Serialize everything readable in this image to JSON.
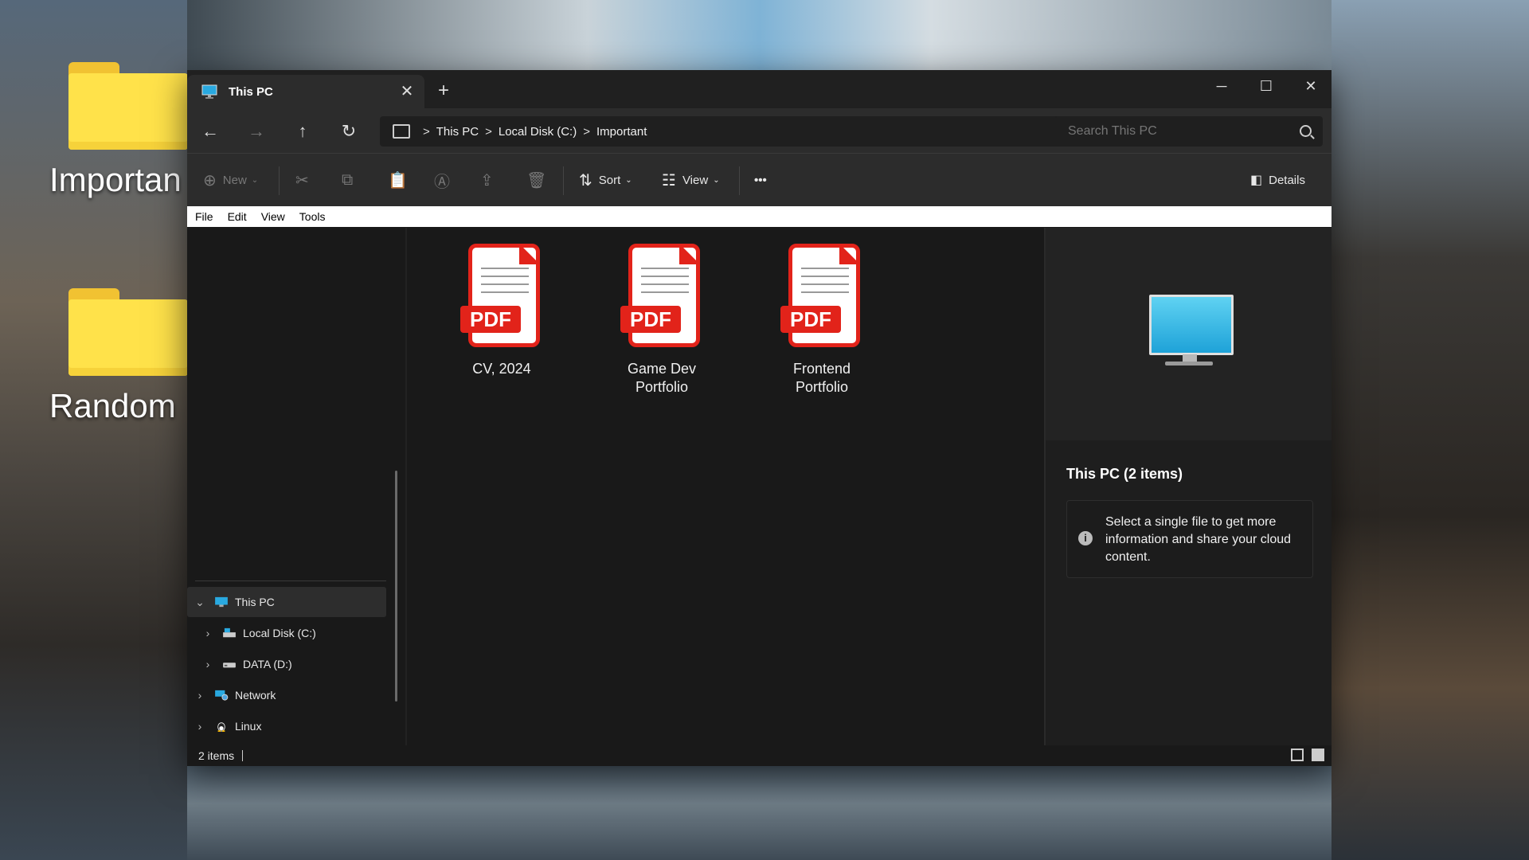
{
  "desktop": {
    "icons": [
      {
        "label": "Importan"
      },
      {
        "label": "Random"
      }
    ]
  },
  "window": {
    "tab_title": "This PC",
    "new_tab_icon": "plus-icon",
    "controls": [
      "minimize",
      "maximize",
      "close"
    ]
  },
  "nav": {
    "breadcrumb": [
      "This PC",
      "Local Disk (C:)",
      "Important"
    ],
    "separator": ">",
    "search_placeholder": "Search This PC"
  },
  "toolbar": {
    "new_label": "New",
    "sort_label": "Sort",
    "view_label": "View",
    "more_label": "•••",
    "details_label": "Details"
  },
  "menubar": {
    "items": [
      "File",
      "Edit",
      "View",
      "Tools"
    ]
  },
  "sidebar": {
    "tree": [
      {
        "label": "This PC",
        "icon": "monitor-icon",
        "expanded": true,
        "selected": true
      },
      {
        "label": "Local Disk (C:)",
        "icon": "drive-icon"
      },
      {
        "label": "DATA (D:)",
        "icon": "drive-icon"
      },
      {
        "label": "Network",
        "icon": "network-icon"
      },
      {
        "label": "Linux",
        "icon": "linux-icon"
      }
    ]
  },
  "files": [
    {
      "name": "CV, 2024",
      "type_badge": "PDF"
    },
    {
      "name": "Game Dev Portfolio",
      "type_badge": "PDF"
    },
    {
      "name": "Frontend Portfolio",
      "type_badge": "PDF"
    }
  ],
  "details_pane": {
    "title": "This PC (2 items)",
    "info_text": "Select a single file to get more information and share your cloud content.",
    "info_icon_glyph": "i"
  },
  "status": {
    "count": "2 items"
  },
  "colors": {
    "pdf_red": "#e2231a",
    "folder_yellow": "#ffe24a",
    "window_bg": "#191919"
  }
}
